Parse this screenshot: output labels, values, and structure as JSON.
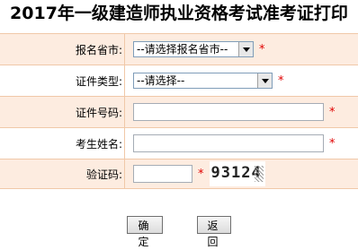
{
  "title": "2017年一级建造师执业资格考试准考证打印",
  "form": {
    "province_label": "报名省市:",
    "province_value": "--请选择报名省市--",
    "id_type_label": "证件类型:",
    "id_type_value": "--请选择--",
    "id_number_label": "证件号码:",
    "id_number_value": "",
    "name_label": "考生姓名:",
    "name_value": "",
    "captcha_label": "验证码:",
    "captcha_value": "",
    "captcha_text": "93124",
    "required_mark": "*"
  },
  "buttons": {
    "confirm": "确定",
    "back": "返回"
  },
  "colors": {
    "row_alt_bg": "#fdece0",
    "border": "#f0c8a8",
    "required": "#e00000"
  }
}
